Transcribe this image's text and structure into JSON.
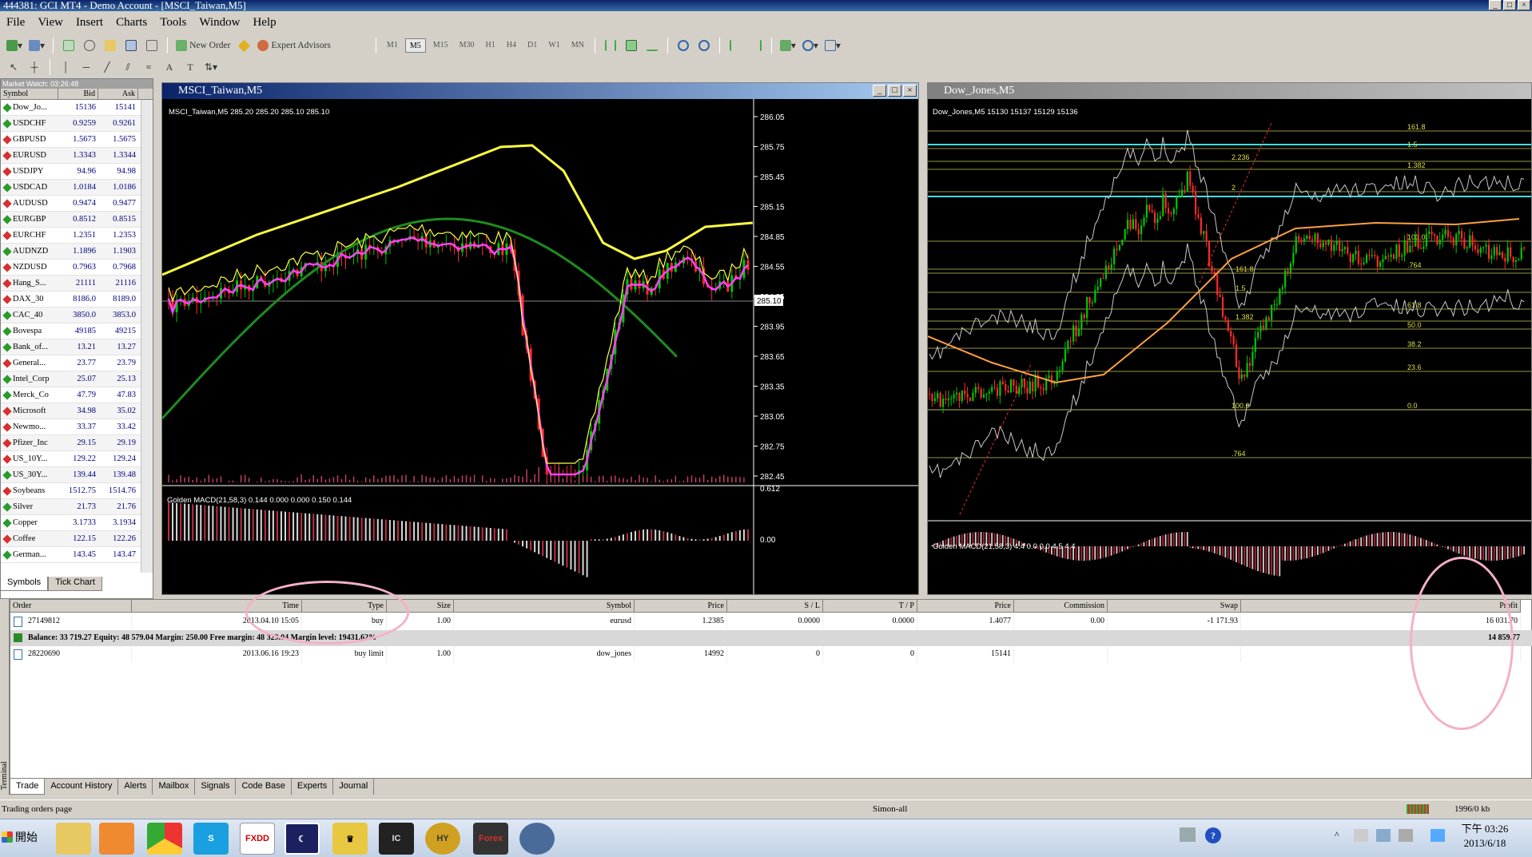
{
  "window": {
    "title": "444381: GCI MT4 - Demo Account - [MSCI_Taiwan,M5]"
  },
  "menu": [
    "File",
    "View",
    "Insert",
    "Charts",
    "Tools",
    "Window",
    "Help"
  ],
  "toolbar": {
    "new_order": "New Order",
    "expert_advisors": "Expert Advisors",
    "timeframes": [
      "M1",
      "M5",
      "M15",
      "M30",
      "H1",
      "H4",
      "D1",
      "W1",
      "MN"
    ],
    "active_timeframe": "M5"
  },
  "market_watch": {
    "title": "Market Watch: 03:26:48",
    "headers": [
      "Symbol",
      "Bid",
      "Ask"
    ],
    "rows": [
      {
        "symbol": "Dow_Jo...",
        "bid": "15136",
        "ask": "15141",
        "dir": "up"
      },
      {
        "symbol": "USDCHF",
        "bid": "0.9259",
        "ask": "0.9261",
        "dir": "up"
      },
      {
        "symbol": "GBPUSD",
        "bid": "1.5673",
        "ask": "1.5675",
        "dir": "down"
      },
      {
        "symbol": "EURUSD",
        "bid": "1.3343",
        "ask": "1.3344",
        "dir": "down"
      },
      {
        "symbol": "USDJPY",
        "bid": "94.96",
        "ask": "94.98",
        "dir": "down"
      },
      {
        "symbol": "USDCAD",
        "bid": "1.0184",
        "ask": "1.0186",
        "dir": "up"
      },
      {
        "symbol": "AUDUSD",
        "bid": "0.9474",
        "ask": "0.9477",
        "dir": "down"
      },
      {
        "symbol": "EURGBP",
        "bid": "0.8512",
        "ask": "0.8515",
        "dir": "up"
      },
      {
        "symbol": "EURCHF",
        "bid": "1.2351",
        "ask": "1.2353",
        "dir": "down"
      },
      {
        "symbol": "AUDNZD",
        "bid": "1.1896",
        "ask": "1.1903",
        "dir": "up"
      },
      {
        "symbol": "NZDUSD",
        "bid": "0.7963",
        "ask": "0.7968",
        "dir": "down"
      },
      {
        "symbol": "Hang_S...",
        "bid": "21111",
        "ask": "21116",
        "dir": "down"
      },
      {
        "symbol": "DAX_30",
        "bid": "8186.0",
        "ask": "8189.0",
        "dir": "down"
      },
      {
        "symbol": "CAC_40",
        "bid": "3850.0",
        "ask": "3853.0",
        "dir": "up"
      },
      {
        "symbol": "Bovespa",
        "bid": "49185",
        "ask": "49215",
        "dir": "up"
      },
      {
        "symbol": "Bank_of...",
        "bid": "13.21",
        "ask": "13.27",
        "dir": "up"
      },
      {
        "symbol": "General...",
        "bid": "23.77",
        "ask": "23.79",
        "dir": "down"
      },
      {
        "symbol": "Intel_Corp",
        "bid": "25.07",
        "ask": "25.13",
        "dir": "up"
      },
      {
        "symbol": "Merck_Co",
        "bid": "47.79",
        "ask": "47.83",
        "dir": "up"
      },
      {
        "symbol": "Microsoft",
        "bid": "34.98",
        "ask": "35.02",
        "dir": "down"
      },
      {
        "symbol": "Newmo...",
        "bid": "33.37",
        "ask": "33.42",
        "dir": "down"
      },
      {
        "symbol": "Pfizer_Inc",
        "bid": "29.15",
        "ask": "29.19",
        "dir": "down"
      },
      {
        "symbol": "US_10Y...",
        "bid": "129.22",
        "ask": "129.24",
        "dir": "down"
      },
      {
        "symbol": "US_30Y...",
        "bid": "139.44",
        "ask": "139.48",
        "dir": "up"
      },
      {
        "symbol": "Soybeans",
        "bid": "1512.75",
        "ask": "1514.76",
        "dir": "down"
      },
      {
        "symbol": "Silver",
        "bid": "21.73",
        "ask": "21.76",
        "dir": "up"
      },
      {
        "symbol": "Copper",
        "bid": "3.1733",
        "ask": "3.1934",
        "dir": "up"
      },
      {
        "symbol": "Coffee",
        "bid": "122.15",
        "ask": "122.26",
        "dir": "down"
      },
      {
        "symbol": "German...",
        "bid": "143.45",
        "ask": "143.47",
        "dir": "up"
      }
    ],
    "tabs": [
      "Symbols",
      "Tick Chart"
    ]
  },
  "chart_msci": {
    "title": "MSCI_Taiwan,M5",
    "info": "MSCI_Taiwan,M5  285.20 285.20 285.10 285.10",
    "price_labels": [
      "286.05",
      "285.75",
      "285.45",
      "285.15",
      "284.85",
      "284.55",
      "284.25",
      "283.95",
      "283.65",
      "283.35",
      "283.05",
      "282.75",
      "282.45"
    ],
    "current_price": "285.10",
    "macd_info": "Golden MACD(21,58,3) 0.144 0.000 0.000 0.150 0.144",
    "macd_labels": [
      "0.612",
      "0.00"
    ]
  },
  "chart_dow": {
    "title": "Dow_Jones,M5",
    "info": "Dow_Jones,M5  15130 15137 15129 15136",
    "fib_labels": [
      "161.8",
      "1.5",
      "1.382",
      "2.236",
      "2",
      "100.0",
      "161.8",
      "1.5",
      "1.382",
      "61.8",
      "50.0",
      "38.2",
      "23.6",
      "100.0",
      "0.0",
      ".764",
      ".764"
    ],
    "macd_info": "Golden MACD(21,58,3) 4.4 0.0 0.0 4.5 4.4"
  },
  "terminal": {
    "headers": [
      "Order",
      "Time",
      "Type",
      "Size",
      "Symbol",
      "Price",
      "S / L",
      "T / P",
      "Price",
      "Commission",
      "Swap",
      "Profit"
    ],
    "rows": [
      [
        "27149812",
        "2013.04.10 15:05",
        "buy",
        "1.00",
        "eurusd",
        "1.2385",
        "0.0000",
        "0.0000",
        "1.4077",
        "0.00",
        "-1 171.93",
        "16 031.70"
      ]
    ],
    "balance": "Balance: 33 719.27  Equity: 48 579.04  Margin: 250.00  Free margin: 48 329.04  Margin level: 19431.62%",
    "balance_profit": "14 859.77",
    "pending": [
      "28220690",
      "2013.06.16 19:23",
      "buy limit",
      "1.00",
      "dow_jones",
      "14992",
      "0",
      "0",
      "15141",
      "",
      "",
      ""
    ],
    "tabs": [
      "Trade",
      "Account History",
      "Alerts",
      "Mailbox",
      "Signals",
      "Code Base",
      "Experts",
      "Journal"
    ],
    "side_label": "Terminal"
  },
  "status": {
    "left": "Trading orders page",
    "mid": "Simon-all",
    "right": "1996/0 kb"
  },
  "taskbar": {
    "start": "開始",
    "clock_time": "下午 03:26",
    "clock_date": "2013/6/18"
  },
  "colors": {
    "bull": "#00c800",
    "bear": "#ff2a2a",
    "yellow": "#ffff40",
    "magenta": "#ff40ff",
    "green_ma": "#1e8c1e",
    "cyan": "#40e0e0",
    "orange": "#ffa040"
  }
}
